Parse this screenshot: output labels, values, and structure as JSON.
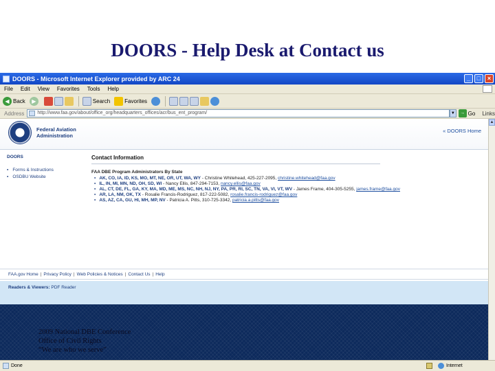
{
  "slide": {
    "title": "DOORS - Help Desk at Contact us",
    "footer_lines": [
      "2009 National DBE Conference",
      "Office of Civil Rights",
      "“We are who we serve”"
    ]
  },
  "browser": {
    "window_title": "DOORS - Microsoft Internet Explorer provided by ARC 24",
    "window_buttons": [
      "_",
      "□",
      "×"
    ],
    "menu": [
      "File",
      "Edit",
      "View",
      "Favorites",
      "Tools",
      "Help"
    ],
    "toolbar": {
      "back": "Back",
      "search": "Search",
      "favorites": "Favorites"
    },
    "address": {
      "label": "Address",
      "url": "http://www.faa.gov/about/office_org/headquarters_offices/acr/bus_ent_program/",
      "go": "Go",
      "links": "Links"
    },
    "status": {
      "left": "Done",
      "zone": "Internet"
    }
  },
  "site": {
    "agency_name": "Federal Aviation Administration",
    "home_link": "« DOORS Home",
    "nav": {
      "heading": "DOORS",
      "items": [
        "Forms & Instructions",
        "OSDBU Website"
      ]
    },
    "main": {
      "heading": "Contact Information",
      "section": "FAA DBE Program Administrators By State",
      "contacts": [
        {
          "states": "AK, CO, IA, ID, KS, MO, MT, NE, OR, UT, WA, WY",
          "person": " - Christine Whitehead, 425-227-2095, ",
          "email": "christine.whitehead@faa.gov"
        },
        {
          "states": "IL, IN, MI, MN, ND, OH, SD, WI",
          "person": " - Nancy Ellis, 847-294-7153, ",
          "email": "nancy.ellis@faa.gov"
        },
        {
          "states": "AL, CT, DE, FL, GA, KY, MA, MD, ME, MS, NC, NH, NJ, NY, PA, PR, RI, SC, TN, VA, VI, VT, WV",
          "person": " - James Frame, 404-305-5255, ",
          "email": "james.frame@faa.gov"
        },
        {
          "states": "AR, LA, NM, OK, TX",
          "person": " - Rosalie Francis-Rodriguez, 817-222-5082, ",
          "email": "rosalie.francis-rodriguez@faa.gov"
        },
        {
          "states": "AS, AZ, CA, GU, HI, MH, MP, NV",
          "person": " - Patricia A. Pitts, 310-725-3342, ",
          "email": "patricia.a.pitts@faa.gov"
        }
      ]
    },
    "footer_links": [
      "FAA.gov Home",
      "Privacy Policy",
      "Web Policies & Notices",
      "Contact Us",
      "Help"
    ],
    "readers": {
      "label": "Readers & Viewers:",
      "link": "PDF Reader"
    }
  }
}
